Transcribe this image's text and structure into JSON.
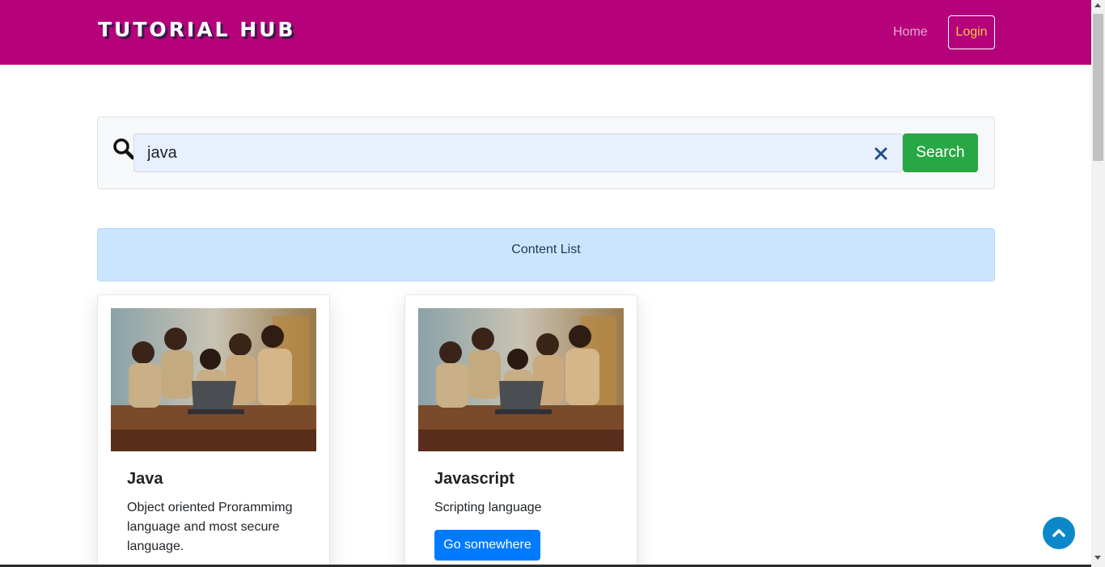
{
  "navbar": {
    "brand": "TUTORIAL HUB",
    "home_label": "Home",
    "login_label": "Login",
    "background_color": "#b5027b"
  },
  "search": {
    "value": "java",
    "placeholder": "",
    "button_label": "Search",
    "search_icon": "search-icon",
    "clear_icon": "close-icon"
  },
  "content_list": {
    "label": "Content List"
  },
  "cards": [
    {
      "title": "Java",
      "text": "Object oriented Prorammimg language and most secure language.",
      "button_label": "",
      "image": "students-with-laptop-photo"
    },
    {
      "title": "Javascript",
      "text": "Scripting language",
      "button_label": "Go somewhere",
      "image": "students-with-laptop-photo"
    }
  ],
  "back_to_top": {
    "icon": "chevron-up-icon"
  },
  "colors": {
    "accent": "#b5027b",
    "search_button": "#28a745",
    "card_button": "#007bff",
    "alert_background": "#cce5ff",
    "back_to_top": "#0c88c9"
  }
}
